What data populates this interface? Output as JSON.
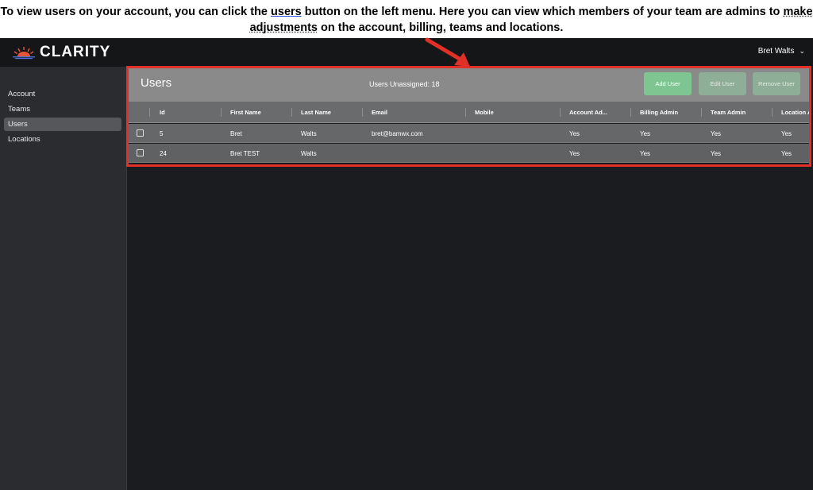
{
  "caption": {
    "part1": "To view users on your account, you can click the ",
    "link_users": "users",
    "part2": " button on the left menu. Here you can view which members of your team are admins to ",
    "link_adjust": "make adjustments",
    "part3": " on the account, billing, teams and locations."
  },
  "app": {
    "logo_text": "CLARITY",
    "user_name": "Bret Walts"
  },
  "sidebar": {
    "items": [
      {
        "label": "Account"
      },
      {
        "label": "Teams"
      },
      {
        "label": "Users"
      },
      {
        "label": "Locations"
      }
    ]
  },
  "users_panel": {
    "title": "Users",
    "unassigned": "Users Unassigned: 18",
    "add_label": "Add User",
    "edit_label": "Edit User",
    "remove_label": "Remove User",
    "columns": [
      "Id",
      "First Name",
      "Last Name",
      "Email",
      "Mobile",
      "Account Ad...",
      "Billing Admin",
      "Team Admin",
      "Location A"
    ],
    "rows": [
      {
        "id": "5",
        "first": "Bret",
        "last": "Walts",
        "email": "bret@bamwx.com",
        "mobile": "",
        "account_admin": "Yes",
        "billing_admin": "Yes",
        "team_admin": "Yes",
        "location_admin": "Yes"
      },
      {
        "id": "24",
        "first": "Bret TEST",
        "last": "Walts",
        "email": "",
        "mobile": "",
        "account_admin": "Yes",
        "billing_admin": "Yes",
        "team_admin": "Yes",
        "location_admin": "Yes"
      }
    ]
  },
  "colors": {
    "highlight": "#e03027",
    "add_button": "#7ec592",
    "panel_header": "#8a8a8a"
  }
}
